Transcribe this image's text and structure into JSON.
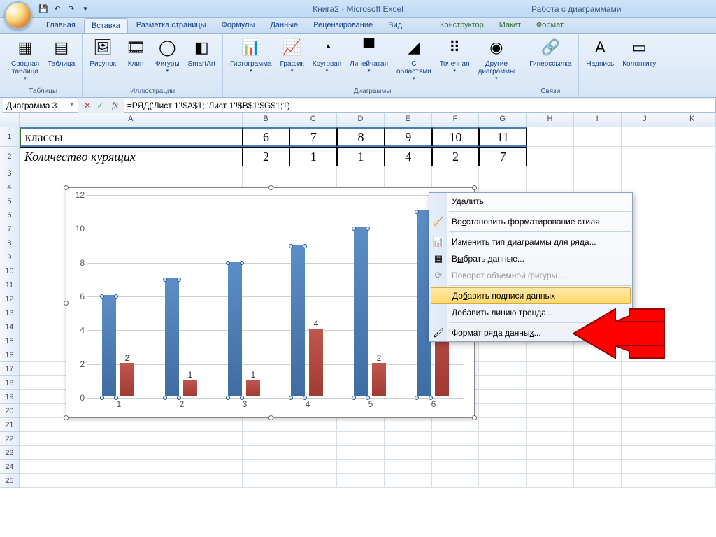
{
  "title": "Книга2 - Microsoft Excel",
  "context_title": "Работа с диаграммами",
  "tabs": {
    "home": "Главная",
    "insert": "Вставка",
    "layout": "Разметка страницы",
    "formulas": "Формулы",
    "data": "Данные",
    "review": "Рецензирование",
    "view": "Вид",
    "design": "Конструктор",
    "chartlayout": "Макет",
    "format": "Формат"
  },
  "ribbon": {
    "groups": {
      "tables": "Таблицы",
      "illustrations": "Иллюстрации",
      "charts": "Диаграммы",
      "links": "Связи"
    },
    "pivot": "Сводная\nтаблица",
    "table": "Таблица",
    "picture": "Рисунок",
    "clip": "Клип",
    "shapes": "Фигуры",
    "smartart": "SmartArt",
    "histogram": "Гистограмма",
    "graph": "График",
    "pie": "Круговая",
    "bar": "Линейчатая",
    "area": "С\nобластями",
    "scatter": "Точечная",
    "other": "Другие\nдиаграммы",
    "hyperlink": "Гиперссылка",
    "textbox": "Надпись",
    "headerfooter": "Колонтиту"
  },
  "namebox": "Диаграмма 3",
  "formula": "=РЯД('Лист 1'!$A$1;;'Лист 1'!$B$1:$G$1;1)",
  "columns": [
    "A",
    "B",
    "C",
    "D",
    "E",
    "F",
    "G",
    "H",
    "I",
    "J",
    "K"
  ],
  "rows": [
    "1",
    "2",
    "3",
    "4",
    "5",
    "6",
    "7",
    "8",
    "9",
    "10",
    "11",
    "12",
    "13",
    "14",
    "15",
    "16",
    "17",
    "18",
    "19",
    "20",
    "21",
    "22",
    "23",
    "24",
    "25"
  ],
  "table": {
    "r1": {
      "label": "классы",
      "vals": [
        "6",
        "7",
        "8",
        "9",
        "10",
        "11"
      ]
    },
    "r2": {
      "label": "Количество курящих",
      "vals": [
        "2",
        "1",
        "1",
        "4",
        "2",
        "7"
      ]
    }
  },
  "chart_data": {
    "type": "bar",
    "categories": [
      "1",
      "2",
      "3",
      "4",
      "5",
      "6"
    ],
    "series": [
      {
        "name": "классы",
        "values": [
          6,
          7,
          8,
          9,
          10,
          11
        ]
      },
      {
        "name": "Количество курящих",
        "values": [
          2,
          1,
          1,
          4,
          2,
          7
        ]
      }
    ],
    "ylim": [
      0,
      12
    ],
    "yticks": [
      0,
      2,
      4,
      6,
      8,
      10,
      12
    ],
    "data_labels_series2": [
      "2",
      "1",
      "1",
      "4",
      "2",
      "7"
    ],
    "xlabel": "",
    "ylabel": "",
    "title": ""
  },
  "context_menu": {
    "delete": "Удалить",
    "reset": "Восстановить форматирование стиля",
    "change_type": "Изменить тип диаграммы для ряда...",
    "select_data": "Выбрать данные...",
    "rotate3d": "Поворот объемной фигуры...",
    "add_labels": "Добавить подписи данных",
    "add_trendline": "Добавить линию тренда...",
    "format_series": "Формат ряда данных..."
  }
}
